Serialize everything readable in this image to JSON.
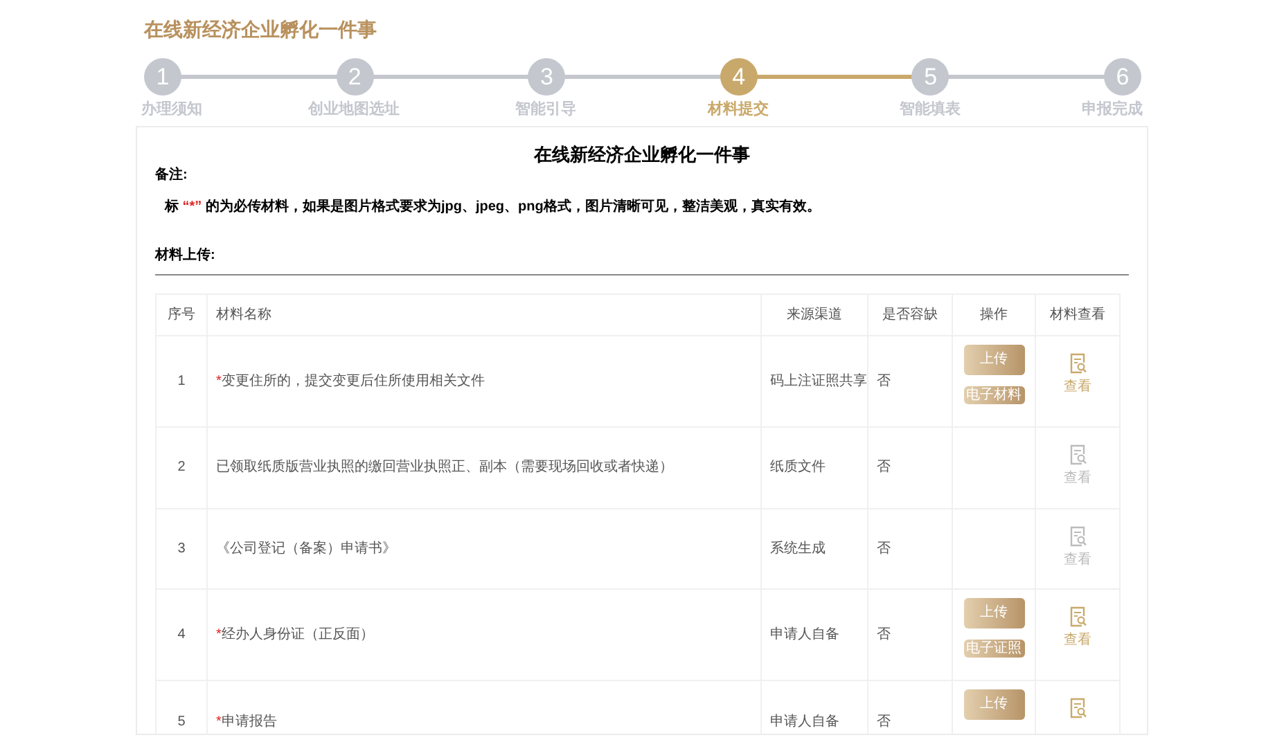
{
  "page_title": "在线新经济企业孵化一件事",
  "steps": [
    {
      "number": "1",
      "label": "办理须知",
      "selected": false
    },
    {
      "number": "2",
      "label": "创业地图选址",
      "selected": false
    },
    {
      "number": "3",
      "label": "智能引导",
      "selected": false
    },
    {
      "number": "4",
      "label": "材料提交",
      "selected": true
    },
    {
      "number": "5",
      "label": "智能填表",
      "selected": false
    },
    {
      "number": "6",
      "label": "申报完成",
      "selected": false
    }
  ],
  "card": {
    "title": "在线新经济企业孵化一件事",
    "note_label": "备注:",
    "note_prefix": "标",
    "note_mark": "“*”",
    "note_text": "的为必传材料，如果是图片格式要求为jpg、jpeg、png格式，图片清晰可见，整洁美观，真实有效。",
    "upload_label": "材料上传:"
  },
  "table": {
    "columns": [
      "序号",
      "材料名称",
      "来源渠道",
      "是否容缺",
      "操作",
      "材料查看"
    ],
    "rows": [
      {
        "index": "1",
        "required_mark": "*",
        "name": "变更住所的，提交变更后住所使用相关文件",
        "source": "码上注证照共享",
        "optional": "否",
        "upload": "上传",
        "badge": "电子材料",
        "view": "查看",
        "view_enabled": true
      },
      {
        "index": "2",
        "name": "已领取纸质版营业执照的缴回营业执照正、副本（需要现场回收或者快递）",
        "source": "纸质文件",
        "optional": "否",
        "view": "查看",
        "view_enabled": false
      },
      {
        "index": "3",
        "name": "《公司登记（备案）申请书》",
        "source": "系统生成",
        "optional": "否",
        "view": "查看",
        "view_enabled": false
      },
      {
        "index": "4",
        "required_mark": "*",
        "name": "经办人身份证（正反面）",
        "source": "申请人自备",
        "optional": "否",
        "upload": "上传",
        "badge": "电子证照",
        "view": "查看",
        "view_enabled": true
      },
      {
        "index": "5",
        "required_mark": "*",
        "name": "申请报告",
        "source": "申请人自备",
        "optional": "否",
        "upload": "上传",
        "view_enabled": true
      }
    ]
  }
}
